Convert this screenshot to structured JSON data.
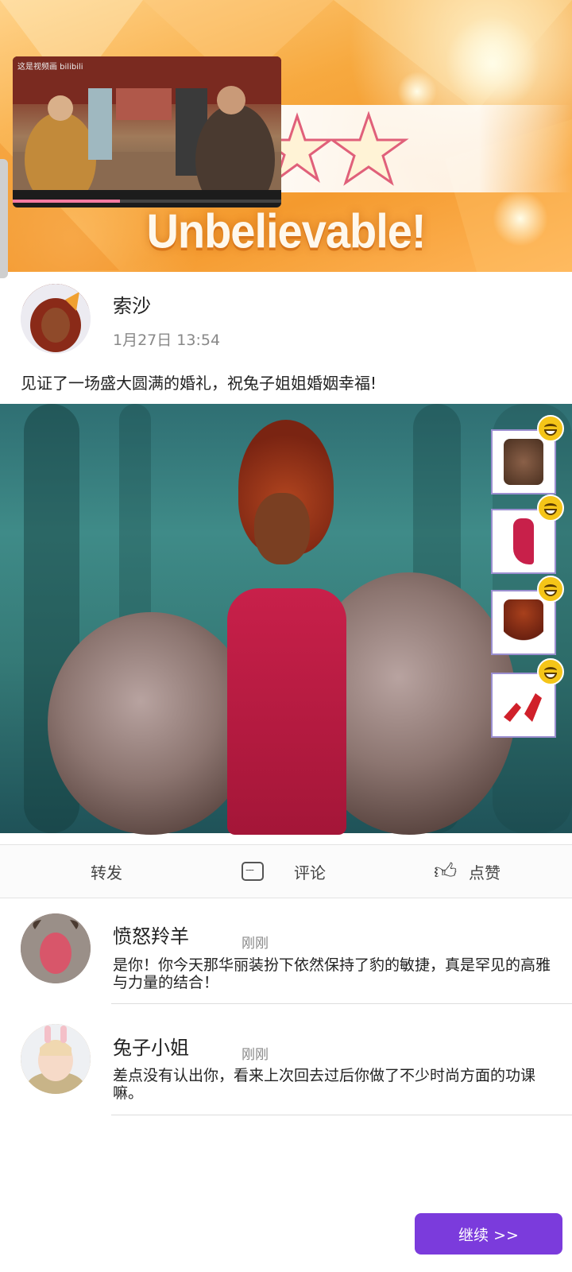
{
  "banner": {
    "headline": "Unbelievable!",
    "stars_shown": 2
  },
  "video": {
    "watermark": "这是视频画 bilibili",
    "progress": 0.4
  },
  "post": {
    "username": "索沙",
    "time": "1月27日 13:54",
    "text": "见证了一场盛大圆满的婚礼，祝兔子姐姐婚姻幸福!"
  },
  "items": [
    {
      "name": "fur-stole",
      "reaction": "smile-icon"
    },
    {
      "name": "red-gown",
      "reaction": "smile-icon"
    },
    {
      "name": "red-hairstyle",
      "reaction": "smile-icon"
    },
    {
      "name": "red-heels",
      "reaction": "smile-icon"
    }
  ],
  "actions": {
    "forward": "转发",
    "comment": "评论",
    "like": "点赞"
  },
  "comments": [
    {
      "name": "愤怒羚羊",
      "time": "刚刚",
      "text": "是你！你今天那华丽装扮下依然保持了豹的敏捷，真是罕见的高雅与力量的结合！"
    },
    {
      "name": "兔子小姐",
      "time": "刚刚",
      "text": "差点没有认出你，看来上次回去过后你做了不少时尚方面的功课嘛。"
    }
  ],
  "continue_button": "继续 >>",
  "colors": {
    "accent": "#7b3bdc",
    "banner": "#f49a2e",
    "dress": "#c8204a"
  }
}
